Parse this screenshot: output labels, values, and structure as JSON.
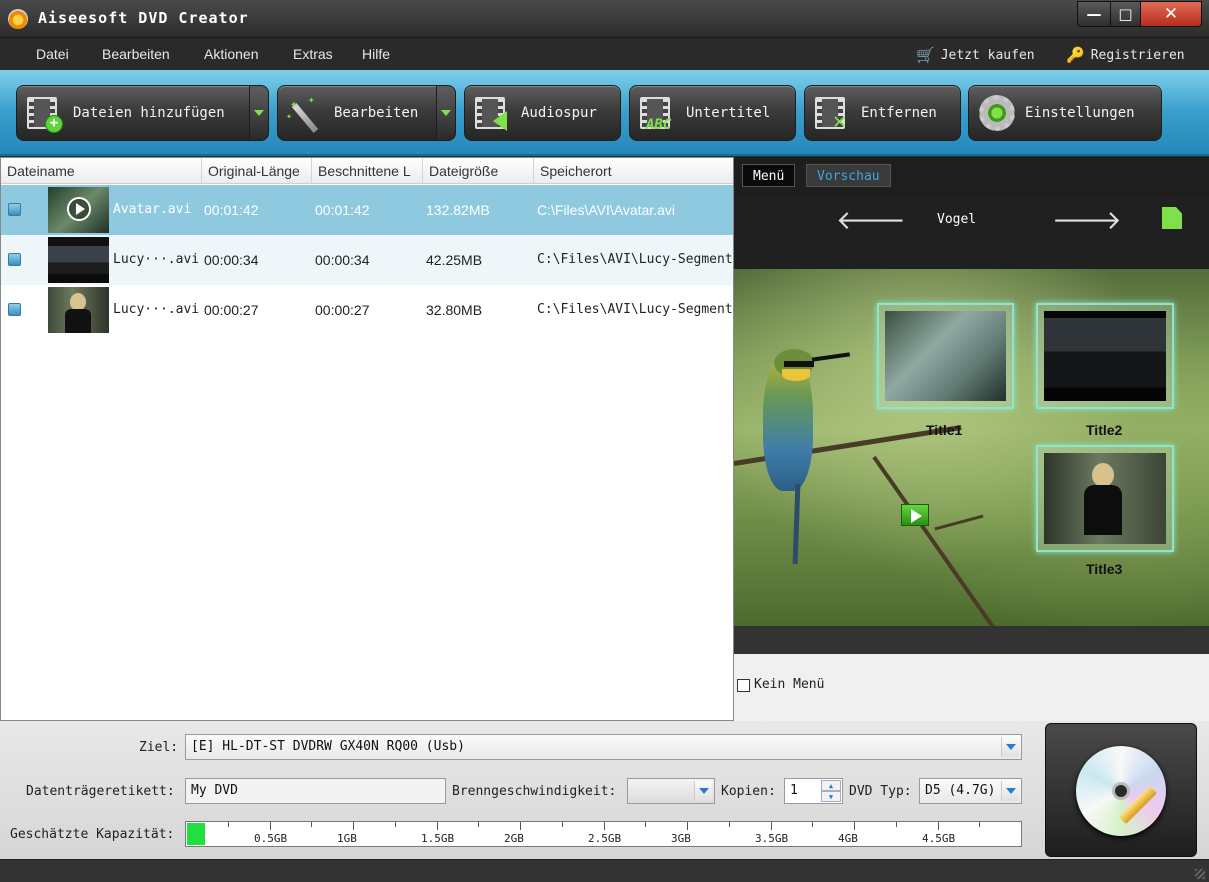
{
  "app": {
    "title": "Aiseesoft DVD Creator"
  },
  "window": {
    "minimize": "—",
    "maximize": "□",
    "close": "✕"
  },
  "menu": {
    "items": [
      "Datei",
      "Bearbeiten",
      "Aktionen",
      "Extras",
      "Hilfe"
    ],
    "buy": "Jetzt kaufen",
    "register": "Registrieren"
  },
  "toolbar": {
    "add_files": "Dateien hinzufügen",
    "edit": "Bearbeiten",
    "audio": "Audiospur",
    "subtitle": "Untertitel",
    "remove": "Entfernen",
    "settings": "Einstellungen",
    "subtitle_icon_text": "ABC"
  },
  "file_list": {
    "columns": [
      "Dateiname",
      "Original-Länge",
      "Beschnittene L",
      "Dateigröße",
      "Speicherort"
    ],
    "rows": [
      {
        "name": "Avatar.avi",
        "original": "00:01:42",
        "trimmed": "00:01:42",
        "size": "132.82MB",
        "path": "C:\\Files\\AVI\\Avatar.avi",
        "selected": true
      },
      {
        "name": "Lucy···.avi",
        "original": "00:00:34",
        "trimmed": "00:00:34",
        "size": "42.25MB",
        "path": "C:\\Files\\AVI\\Lucy-Segment",
        "selected": false
      },
      {
        "name": "Lucy···.avi",
        "original": "00:00:27",
        "trimmed": "00:00:27",
        "size": "32.80MB",
        "path": "C:\\Files\\AVI\\Lucy-Segment",
        "selected": false
      }
    ]
  },
  "preview": {
    "tabs": [
      {
        "label": "Menü",
        "active": true
      },
      {
        "label": "Vorschau",
        "active": false
      }
    ],
    "template_name": "Vogel",
    "titles": [
      "Title1",
      "Title2",
      "Title3"
    ],
    "no_menu_label": "Kein Menü",
    "no_menu_checked": false
  },
  "bottom": {
    "target_label": "Ziel:",
    "target_value": "[E] HL-DT-ST DVDRW  GX40N RQ00 (Usb)",
    "disc_label_label": "Datenträgeretikett:",
    "disc_label_value": "My DVD",
    "burn_speed_label": "Brenngeschwindigkeit:",
    "burn_speed_value": "",
    "copies_label": "Kopien:",
    "copies_value": "1",
    "dvd_type_label": "DVD Typ:",
    "dvd_type_value": "D5 (4.7G)",
    "capacity_label": "Geschätzte Kapazität:",
    "capacity_ticks": [
      "0.5GB",
      "1GB",
      "1.5GB",
      "2GB",
      "2.5GB",
      "3GB",
      "3.5GB",
      "4GB",
      "4.5GB"
    ],
    "capacity_used_fraction": 0.022
  },
  "colors": {
    "accent": "#3a9ecb",
    "selected_row": "#8fc9e0",
    "capacity_fill": "#1fe040"
  }
}
